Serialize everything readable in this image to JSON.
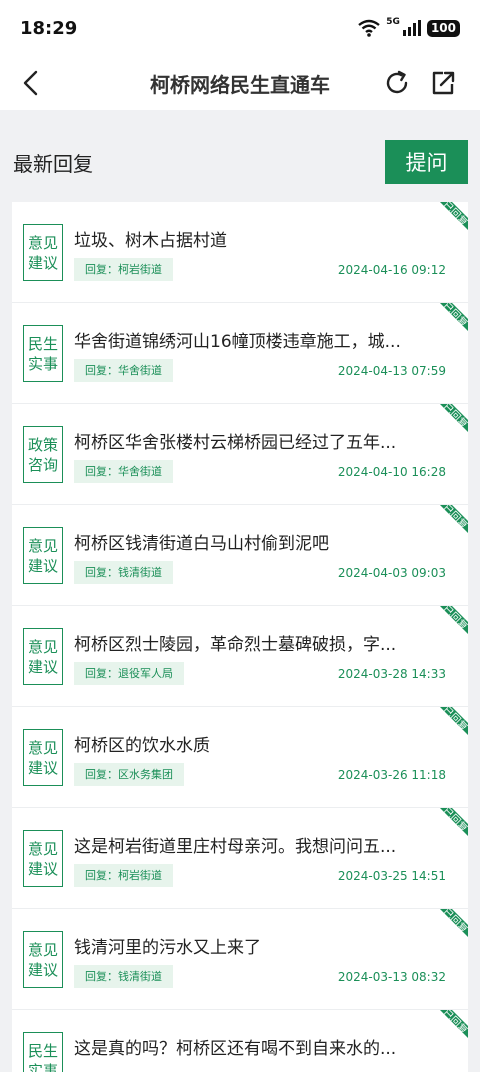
{
  "status": {
    "time": "18:29",
    "signal_label": "5G",
    "battery": "100"
  },
  "nav": {
    "title": "柯桥网络民生直通车"
  },
  "section": {
    "title": "最新回复",
    "ask_label": "提问"
  },
  "ribbon_text": "已回复",
  "items": [
    {
      "cat1": "意见",
      "cat2": "建议",
      "title": "垃圾、树木占据村道",
      "reply": "回复：柯岩街道",
      "date": "2024-04-16 09:12"
    },
    {
      "cat1": "民生",
      "cat2": "实事",
      "title": "华舍街道锦绣河山16幢顶楼违章施工，城...",
      "reply": "回复：华舍街道",
      "date": "2024-04-13 07:59"
    },
    {
      "cat1": "政策",
      "cat2": "咨询",
      "title": "柯桥区华舍张楼村云梯桥园已经过了五年...",
      "reply": "回复：华舍街道",
      "date": "2024-04-10 16:28"
    },
    {
      "cat1": "意见",
      "cat2": "建议",
      "title": "柯桥区钱清街道白马山村偷到泥吧",
      "reply": "回复：钱清街道",
      "date": "2024-04-03 09:03"
    },
    {
      "cat1": "意见",
      "cat2": "建议",
      "title": "柯桥区烈士陵园，革命烈士墓碑破损，字...",
      "reply": "回复：退役军人局",
      "date": "2024-03-28 14:33"
    },
    {
      "cat1": "意见",
      "cat2": "建议",
      "title": "柯桥区的饮水水质",
      "reply": "回复：区水务集团",
      "date": "2024-03-26 11:18"
    },
    {
      "cat1": "意见",
      "cat2": "建议",
      "title": "这是柯岩街道里庄村母亲河。我想问问五...",
      "reply": "回复：柯岩街道",
      "date": "2024-03-25 14:51"
    },
    {
      "cat1": "意见",
      "cat2": "建议",
      "title": "钱清河里的污水又上来了",
      "reply": "回复：钱清街道",
      "date": "2024-03-13 08:32"
    },
    {
      "cat1": "民生",
      "cat2": "实事",
      "title": "这是真的吗？柯桥区还有喝不到自来水的...",
      "reply": "",
      "date": ""
    }
  ]
}
